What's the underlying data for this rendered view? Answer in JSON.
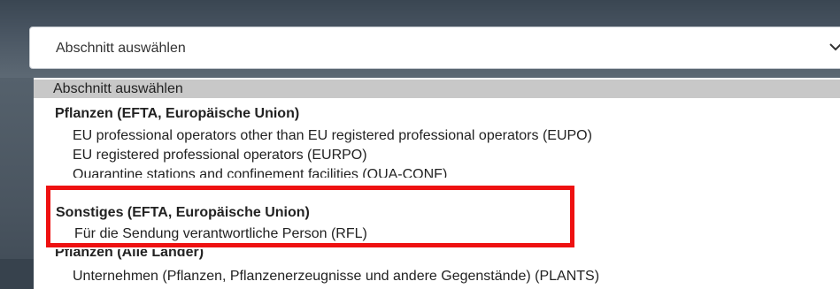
{
  "select": {
    "value": "Abschnitt auswählen"
  },
  "dropdown": {
    "placeholder": "Abschnitt auswählen",
    "group1": "Pflanzen (EFTA, Europäische Union)",
    "item1": "EU professional operators other than EU registered professional operators (EUPO)",
    "item2": "EU registered professional operators (EURPO)",
    "item3": "Quarantine stations and confinement facilities (QUA-CONF)",
    "group2": "Sonstiges (EFTA, Europäische Union)",
    "item4": "Für die Sendung verantwortliche Person (RFL)",
    "group3": "Pflanzen (Alle Länder)",
    "item5": "Unternehmen (Pflanzen, Pflanzenerzeugnisse und andere Gegenstände) (PLANTS)"
  },
  "colors": {
    "highlight": "#ee1111",
    "selected_option": "#c8c8c8"
  }
}
